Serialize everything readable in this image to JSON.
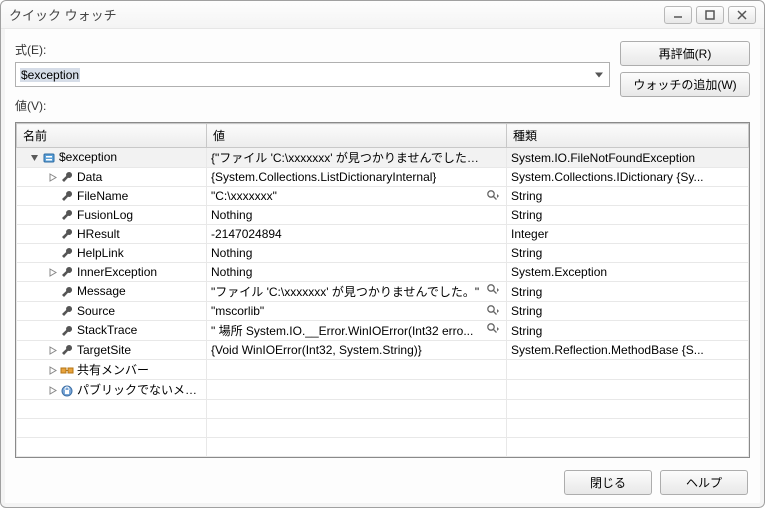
{
  "window": {
    "title": "クイック ウォッチ"
  },
  "labels": {
    "expression": "式(E):",
    "value": "値(V):"
  },
  "buttons": {
    "reevaluate": "再評価(R)",
    "addWatch": "ウォッチの追加(W)",
    "close": "閉じる",
    "help": "ヘルプ"
  },
  "expression": "$exception",
  "grid": {
    "headers": {
      "name": "名前",
      "value": "値",
      "type": "種類"
    },
    "rows": [
      {
        "depth": 0,
        "expander": "open",
        "icon": "obj",
        "name": "$exception",
        "value": "{\"ファイル 'C:\\xxxxxxx' が見つかりませんでした。\":\"C...",
        "mag": false,
        "type": "System.IO.FileNotFoundException",
        "selected": true
      },
      {
        "depth": 1,
        "expander": "closed",
        "icon": "wrench",
        "name": "Data",
        "value": "{System.Collections.ListDictionaryInternal}",
        "mag": false,
        "type": "System.Collections.IDictionary {Sy..."
      },
      {
        "depth": 1,
        "expander": "none",
        "icon": "wrench",
        "name": "FileName",
        "value": "\"C:\\xxxxxxx\"",
        "mag": true,
        "type": "String"
      },
      {
        "depth": 1,
        "expander": "none",
        "icon": "wrench",
        "name": "FusionLog",
        "value": "Nothing",
        "mag": false,
        "type": "String"
      },
      {
        "depth": 1,
        "expander": "none",
        "icon": "wrench",
        "name": "HResult",
        "value": "-2147024894",
        "mag": false,
        "type": "Integer"
      },
      {
        "depth": 1,
        "expander": "none",
        "icon": "wrench",
        "name": "HelpLink",
        "value": "Nothing",
        "mag": false,
        "type": "String"
      },
      {
        "depth": 1,
        "expander": "closed",
        "icon": "wrench",
        "name": "InnerException",
        "value": "Nothing",
        "mag": false,
        "type": "System.Exception"
      },
      {
        "depth": 1,
        "expander": "none",
        "icon": "wrench",
        "name": "Message",
        "value": "\"ファイル 'C:\\xxxxxxx' が見つかりませんでした。\"",
        "mag": true,
        "type": "String"
      },
      {
        "depth": 1,
        "expander": "none",
        "icon": "wrench",
        "name": "Source",
        "value": "\"mscorlib\"",
        "mag": true,
        "type": "String"
      },
      {
        "depth": 1,
        "expander": "none",
        "icon": "wrench",
        "name": "StackTrace",
        "value": "\"   場所 System.IO.__Error.WinIOError(Int32 erro...",
        "mag": true,
        "type": "String"
      },
      {
        "depth": 1,
        "expander": "closed",
        "icon": "wrench",
        "name": "TargetSite",
        "value": "{Void WinIOError(Int32, System.String)}",
        "mag": false,
        "type": "System.Reflection.MethodBase {S..."
      },
      {
        "depth": 1,
        "expander": "closed",
        "icon": "shared",
        "name": "共有メンバー",
        "value": "",
        "mag": false,
        "type": ""
      },
      {
        "depth": 1,
        "expander": "closed",
        "icon": "nonpub",
        "name": "パブリックでないメン...",
        "value": "",
        "mag": false,
        "type": ""
      }
    ]
  }
}
